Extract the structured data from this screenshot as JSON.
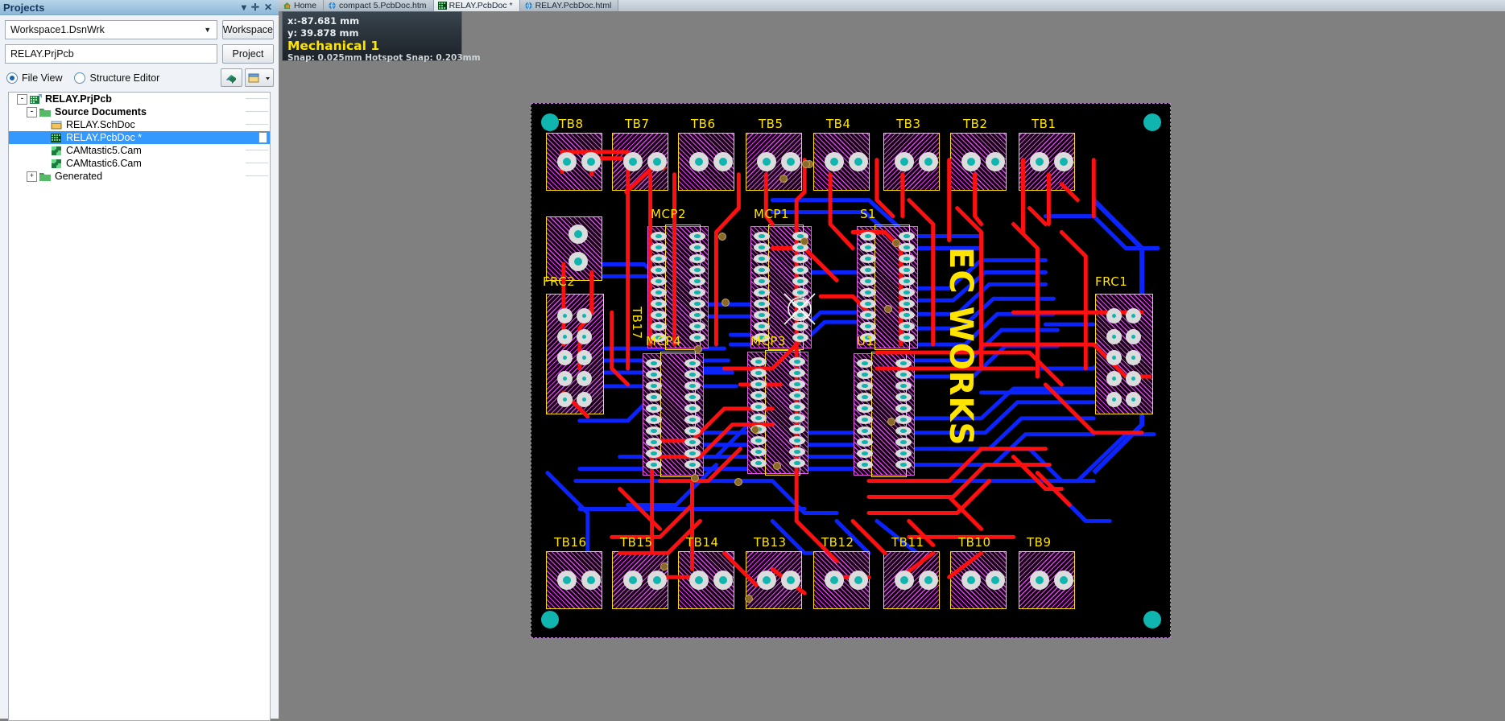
{
  "panel": {
    "caption": "Projects",
    "caption_buttons": [
      "▾",
      "✛",
      "✕"
    ],
    "workspace_combo": {
      "value": "Workspace1.DsnWrk",
      "button": "Workspace"
    },
    "project_combo": {
      "value": "RELAY.PrjPcb",
      "button": "Project"
    },
    "view_modes": [
      {
        "label": "File View",
        "selected": true
      },
      {
        "label": "Structure Editor",
        "selected": false
      }
    ],
    "tree": [
      {
        "label": "RELAY.PrjPcb",
        "indent": 0,
        "expander": "-",
        "icon": "pcb-project-icon",
        "bold": true,
        "selected": false,
        "rule": true,
        "doc": false
      },
      {
        "label": "Source Documents",
        "indent": 1,
        "expander": "-",
        "icon": "folder-icon",
        "bold": true,
        "selected": false,
        "rule": true,
        "doc": false
      },
      {
        "label": "RELAY.SchDoc",
        "indent": 2,
        "expander": "",
        "icon": "schematic-doc-icon",
        "bold": false,
        "selected": false,
        "rule": true,
        "doc": false
      },
      {
        "label": "RELAY.PcbDoc *",
        "indent": 2,
        "expander": "",
        "icon": "pcb-doc-icon",
        "bold": false,
        "selected": true,
        "rule": false,
        "doc": true
      },
      {
        "label": "CAMtastic5.Cam",
        "indent": 2,
        "expander": "",
        "icon": "cam-doc-icon",
        "bold": false,
        "selected": false,
        "rule": true,
        "doc": false
      },
      {
        "label": "CAMtastic6.Cam",
        "indent": 2,
        "expander": "",
        "icon": "cam-doc-icon",
        "bold": false,
        "selected": false,
        "rule": true,
        "doc": false
      },
      {
        "label": "Generated",
        "indent": 1,
        "expander": "+",
        "icon": "folder-icon",
        "bold": false,
        "selected": false,
        "rule": true,
        "doc": false
      }
    ]
  },
  "tabs": [
    {
      "label": "Home",
      "icon": "home-icon",
      "active": false
    },
    {
      "label": "compact 5.PcbDoc.htm",
      "icon": "browser-icon",
      "active": false
    },
    {
      "label": "RELAY.PcbDoc *",
      "icon": "pcb-doc-icon",
      "active": true
    },
    {
      "label": "RELAY.PcbDoc.html",
      "icon": "browser-icon",
      "active": false
    }
  ],
  "status": {
    "x": "x:-87.681  mm",
    "y": "y: 39.878  mm",
    "layer": "Mechanical 1",
    "snap": "Snap: 0.025mm Hotspot Snap: 0.203mm"
  },
  "board": {
    "designators": {
      "top_row": [
        "TB8",
        "TB7",
        "TB6",
        "TB5",
        "TB4",
        "TB3",
        "TB2",
        "TB1"
      ],
      "bottom_row": [
        "TB16",
        "TB15",
        "TB14",
        "TB13",
        "TB12",
        "TB11",
        "TB10",
        "TB9"
      ],
      "ics": [
        "MCP2",
        "MCP1",
        "S1",
        "MCP4",
        "MCP3",
        "U1"
      ],
      "connectors": [
        "TB17",
        "FRC2",
        "FRC1"
      ],
      "silkscreen": "EC WORKS"
    },
    "colors": {
      "top_layer": "#ff0000",
      "bottom_layer": "#0000ff",
      "silkscreen": "#ffe400",
      "pad": "#dcdcdc",
      "hole": "#0fb5ae",
      "keepout": "#d946ef",
      "board_outline": "#c57ce0",
      "background": "#000000"
    }
  }
}
